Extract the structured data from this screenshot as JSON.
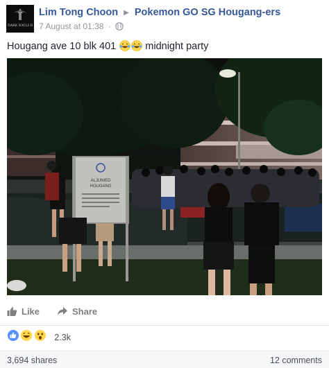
{
  "post": {
    "author": "Lim Tong Choon",
    "group": "Pokemon GO SG Hougang-ers",
    "timestamp": "7 August at 01:38",
    "privacy_icon": "globe-icon",
    "avatar_text": "DARK SOULS II",
    "text": "Hougang ave 10 blk 401",
    "text_emojis": [
      "laughing-tears-emoji",
      "laughing-tears-emoji"
    ],
    "text_after": "midnight party",
    "photo_sign_text": [
      "ALJUNIED",
      "HOUGANG"
    ]
  },
  "actions": {
    "like_label": "Like",
    "share_label": "Share"
  },
  "reactions": {
    "icons": [
      "like-reaction",
      "haha-reaction",
      "wow-reaction"
    ],
    "count": "2.3k"
  },
  "footer": {
    "shares": "3,694 shares",
    "comments": "12 comments"
  },
  "colors": {
    "link": "#365899",
    "meta": "#90949c",
    "action": "#7f7f7f",
    "like_blue": "#5890ff",
    "emoji_yellow": "#ffd64c"
  }
}
